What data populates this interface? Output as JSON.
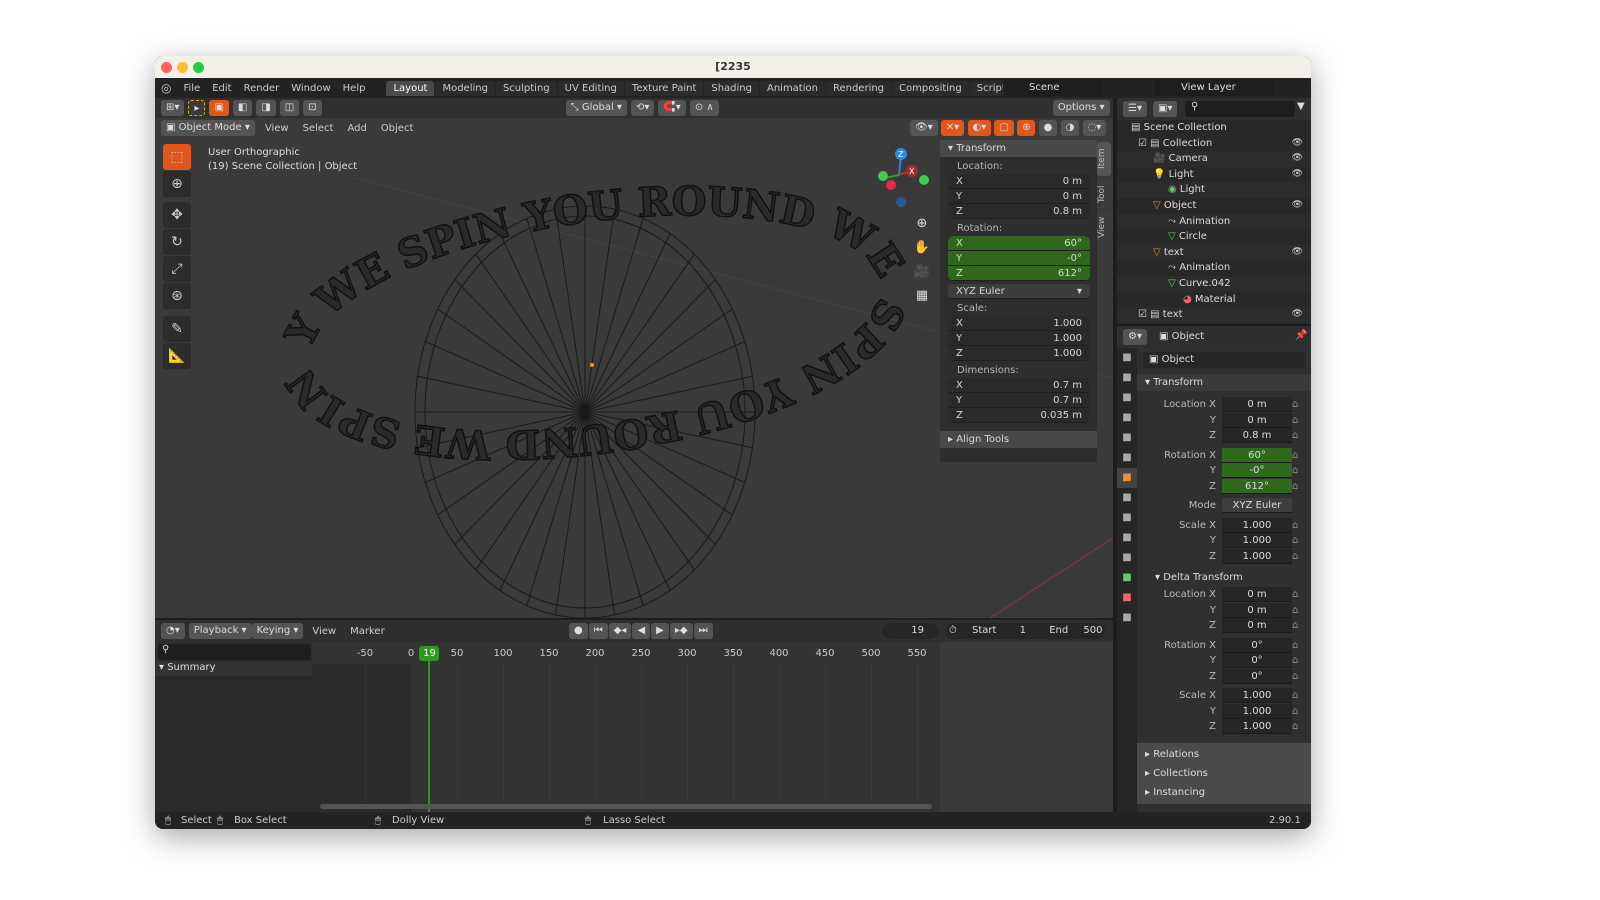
{
  "window": {
    "title": "[2235"
  },
  "menu": {
    "items": [
      "File",
      "Edit",
      "Render",
      "Window",
      "Help"
    ]
  },
  "workspaces": [
    {
      "label": "Layout",
      "active": true
    },
    {
      "label": "Modeling"
    },
    {
      "label": "Sculpting"
    },
    {
      "label": "UV Editing"
    },
    {
      "label": "Texture Paint"
    },
    {
      "label": "Shading"
    },
    {
      "label": "Animation"
    },
    {
      "label": "Rendering"
    },
    {
      "label": "Compositing"
    },
    {
      "label": "Scripting"
    },
    {
      "label": "+"
    }
  ],
  "scene": {
    "name": "Scene",
    "view_layer": "View Layer"
  },
  "viewport": {
    "orientation": "Global",
    "options": "Options",
    "mode": "Object Mode",
    "header_menus": [
      "View",
      "Select",
      "Add",
      "Object"
    ],
    "view_name": "User Orthographic",
    "view_info": "(19) Scene Collection | Object",
    "scene_text": "WE SPIN YOU ROUND WE SPIN YOU ROUND WE SPIN YOU ROUND ",
    "gizmo_axes": [
      "Z",
      "Y",
      "X"
    ]
  },
  "npanel": {
    "title": "Transform",
    "tabs": [
      "Item",
      "Tool",
      "View"
    ],
    "location_label": "Location:",
    "location": [
      [
        "X",
        "0 m"
      ],
      [
        "Y",
        "0 m"
      ],
      [
        "Z",
        "0.8 m"
      ]
    ],
    "rotation_label": "Rotation:",
    "rotation": [
      [
        "X",
        "60°"
      ],
      [
        "Y",
        "-0°"
      ],
      [
        "Z",
        "612°"
      ]
    ],
    "rotation_mode": "XYZ Euler",
    "scale_label": "Scale:",
    "scale": [
      [
        "X",
        "1.000"
      ],
      [
        "Y",
        "1.000"
      ],
      [
        "Z",
        "1.000"
      ]
    ],
    "dimensions_label": "Dimensions:",
    "dimensions": [
      [
        "X",
        "0.7 m"
      ],
      [
        "Y",
        "0.7 m"
      ],
      [
        "Z",
        "0.035 m"
      ]
    ],
    "align_tools": "Align Tools"
  },
  "outliner": {
    "root": "Scene Collection",
    "rows": [
      {
        "label": "Collection",
        "depth": 1,
        "icon": "collection-icon",
        "eye": true,
        "check": true
      },
      {
        "label": "Camera",
        "depth": 2,
        "icon": "camera-icon",
        "eye": true
      },
      {
        "label": "Light",
        "depth": 2,
        "icon": "light-icon",
        "eye": true
      },
      {
        "label": "Light",
        "depth": 3,
        "icon": "light-data-icon"
      },
      {
        "label": "Object",
        "depth": 2,
        "icon": "object-icon",
        "eye": true
      },
      {
        "label": "Animation",
        "depth": 3,
        "icon": "animation-icon"
      },
      {
        "label": "Circle",
        "depth": 3,
        "icon": "mesh-icon"
      },
      {
        "label": "text",
        "depth": 2,
        "icon": "object-icon",
        "eye": true
      },
      {
        "label": "Animation",
        "depth": 3,
        "icon": "animation-icon"
      },
      {
        "label": "Curve.042",
        "depth": 3,
        "icon": "curve-icon"
      },
      {
        "label": "Material",
        "depth": 4,
        "icon": "material-icon"
      },
      {
        "label": "text",
        "depth": 1,
        "icon": "collection-icon",
        "eye": true,
        "check": true
      }
    ]
  },
  "properties": {
    "object_name": "Object",
    "object_field": "Object",
    "transform_title": "Transform",
    "location": [
      [
        "Location X",
        "0 m"
      ],
      [
        "Y",
        "0 m"
      ],
      [
        "Z",
        "0.8 m"
      ]
    ],
    "rotation": [
      [
        "Rotation X",
        "60°"
      ],
      [
        "Y",
        "-0°"
      ],
      [
        "Z",
        "612°"
      ]
    ],
    "mode_label": "Mode",
    "mode": "XYZ Euler",
    "scale": [
      [
        "Scale X",
        "1.000"
      ],
      [
        "Y",
        "1.000"
      ],
      [
        "Z",
        "1.000"
      ]
    ],
    "delta_title": "Delta Transform",
    "delta_location": [
      [
        "Location X",
        "0 m"
      ],
      [
        "Y",
        "0 m"
      ],
      [
        "Z",
        "0 m"
      ]
    ],
    "delta_rotation": [
      [
        "Rotation X",
        "0°"
      ],
      [
        "Y",
        "0°"
      ],
      [
        "Z",
        "0°"
      ]
    ],
    "delta_scale": [
      [
        "Scale X",
        "1.000"
      ],
      [
        "Y",
        "1.000"
      ],
      [
        "Z",
        "1.000"
      ]
    ],
    "collapsed": [
      "Relations",
      "Collections",
      "Instancing"
    ]
  },
  "timeline": {
    "menus": [
      "Playback",
      "Keying",
      "View",
      "Marker"
    ],
    "current_frame": "19",
    "start_label": "Start",
    "start": "1",
    "end_label": "End",
    "end": "500",
    "summary": "Summary",
    "ticks": [
      "-50",
      "0",
      "50",
      "100",
      "150",
      "200",
      "250",
      "300",
      "350",
      "400",
      "450",
      "500",
      "550"
    ]
  },
  "status": {
    "select": "Select",
    "box_select": "Box Select",
    "dolly": "Dolly View",
    "lasso": "Lasso Select",
    "version": "2.90.1"
  },
  "colors": {
    "accent": "#e2561a",
    "active_green": "#2f6a1c",
    "frame_green": "#2d9a1f"
  }
}
